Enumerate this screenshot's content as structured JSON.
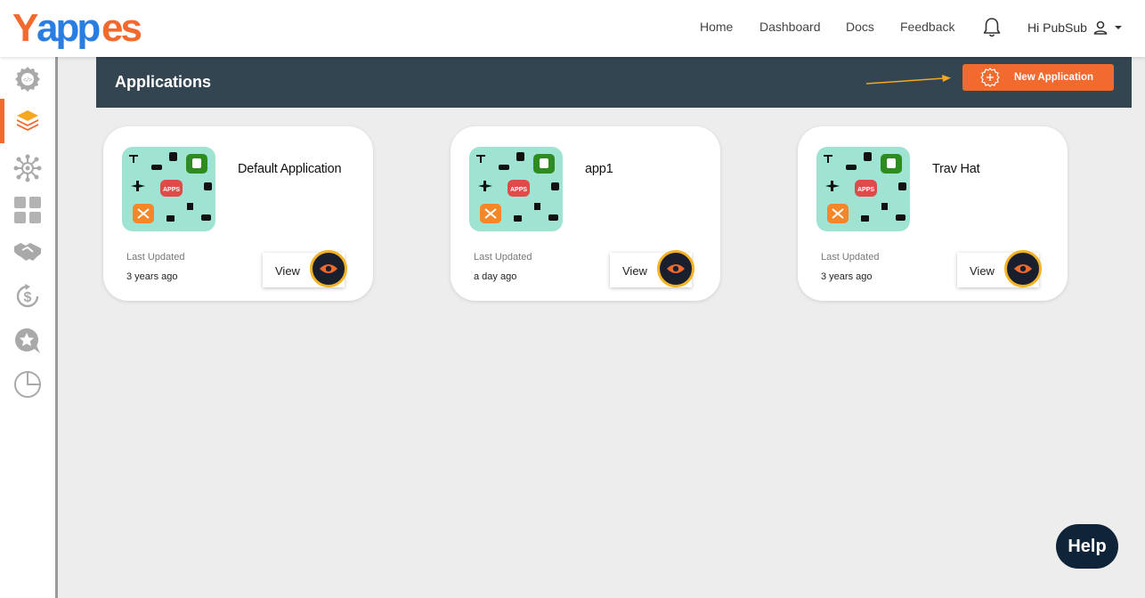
{
  "brand": {
    "logo_text": "Yappes"
  },
  "nav": {
    "home": "Home",
    "dashboard": "Dashboard",
    "docs": "Docs",
    "feedback": "Feedback",
    "greeting": "Hi PubSub"
  },
  "sidebar": {
    "items": [
      {
        "icon": "api-gear-icon"
      },
      {
        "icon": "layers-icon",
        "active": true
      },
      {
        "icon": "network-icon"
      },
      {
        "icon": "grid-icon"
      },
      {
        "icon": "handshake-icon"
      },
      {
        "icon": "dollar-refresh-icon"
      },
      {
        "icon": "star-chat-icon"
      },
      {
        "icon": "pie-chart-icon"
      }
    ]
  },
  "header": {
    "title": "Applications",
    "new_app_label": "New Application"
  },
  "cards": [
    {
      "name": "Default Application",
      "last_updated_label": "Last Updated",
      "last_updated": "3 years ago",
      "view_label": "View"
    },
    {
      "name": "app1",
      "last_updated_label": "Last Updated",
      "last_updated": "a day ago",
      "view_label": "View"
    },
    {
      "name": "Trav Hat",
      "last_updated_label": "Last Updated",
      "last_updated": "3 years ago",
      "view_label": "View"
    }
  ],
  "thumb_badge": "APPS",
  "help": {
    "label": "Help"
  },
  "colors": {
    "accent": "#f26a2e",
    "header_bg": "#344552",
    "eye_ring": "#f5b223",
    "logo_blue": "#2a7de1"
  }
}
